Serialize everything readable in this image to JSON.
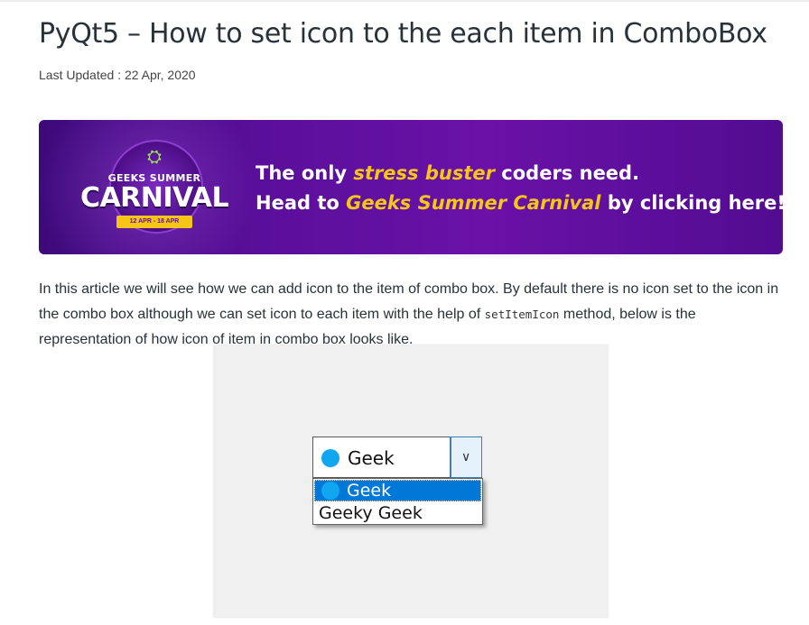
{
  "article": {
    "title": "PyQt5 – How to set icon to the each item in ComboBox",
    "updated": "Last Updated : 22 Apr, 2020"
  },
  "banner": {
    "logo_top": "GEEKS SUMMER",
    "logo_main": "CARNIVAL",
    "logo_dates": "12 APR - 18 APR",
    "line1_a": "The only ",
    "line1_hl": "stress buster",
    "line1_b": " coders need.",
    "line2_a": "Head to ",
    "line2_hl": "Geeks Summer Carnival",
    "line2_b": " by clicking here!",
    "accent_color": "#f5c518",
    "background_color": "#5a0f9a"
  },
  "body": {
    "p1": "In this article we will see how we can add icon to the item of combo box. By default there is no icon set to the icon in the combo box although we can set icon to each item with the help of ",
    "code": "setItemIcon",
    "p2": " method, below is the representation of how icon of item in combo box looks like."
  },
  "demo": {
    "combo_value": "Geek",
    "items": [
      "Geek",
      "Geeky Geek"
    ],
    "selected_index": 0,
    "icon_color": "#10a6f0",
    "highlight_color": "#0078d7"
  }
}
